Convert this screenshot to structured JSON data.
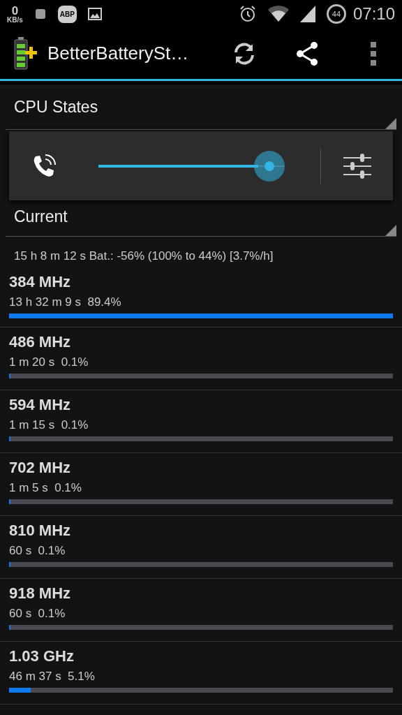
{
  "status_bar": {
    "net_speed": "0",
    "net_unit": "KB/s",
    "adblock_label": "ABP",
    "battery": "44",
    "time": "07:10"
  },
  "action_bar": {
    "title": "BetterBatterySt…"
  },
  "spinners": [
    {
      "value": "CPU States"
    },
    {
      "value": "Current"
    }
  ],
  "volume_panel": {
    "level": 0.86
  },
  "summary": "15 h 8 m 12 s  Bat.: -56% (100% to 44%) [3.7%/h]",
  "states": [
    {
      "frequency": "384 MHz",
      "duration": "13 h 32 m 9 s",
      "share": "89.4%",
      "level": 1.0
    },
    {
      "frequency": "486 MHz",
      "duration": "1 m 20 s",
      "share": "0.1%",
      "level": 0.002
    },
    {
      "frequency": "594 MHz",
      "duration": "1 m 15 s",
      "share": "0.1%",
      "level": 0.002
    },
    {
      "frequency": "702 MHz",
      "duration": "1 m 5 s",
      "share": "0.1%",
      "level": 0.001
    },
    {
      "frequency": "810 MHz",
      "duration": "60 s",
      "share": "0.1%",
      "level": 0.001
    },
    {
      "frequency": "918 MHz",
      "duration": "60 s",
      "share": "0.1%",
      "level": 0.001
    },
    {
      "frequency": "1.03 GHz",
      "duration": "46 m 37 s",
      "share": "5.1%",
      "level": 0.057
    }
  ]
}
